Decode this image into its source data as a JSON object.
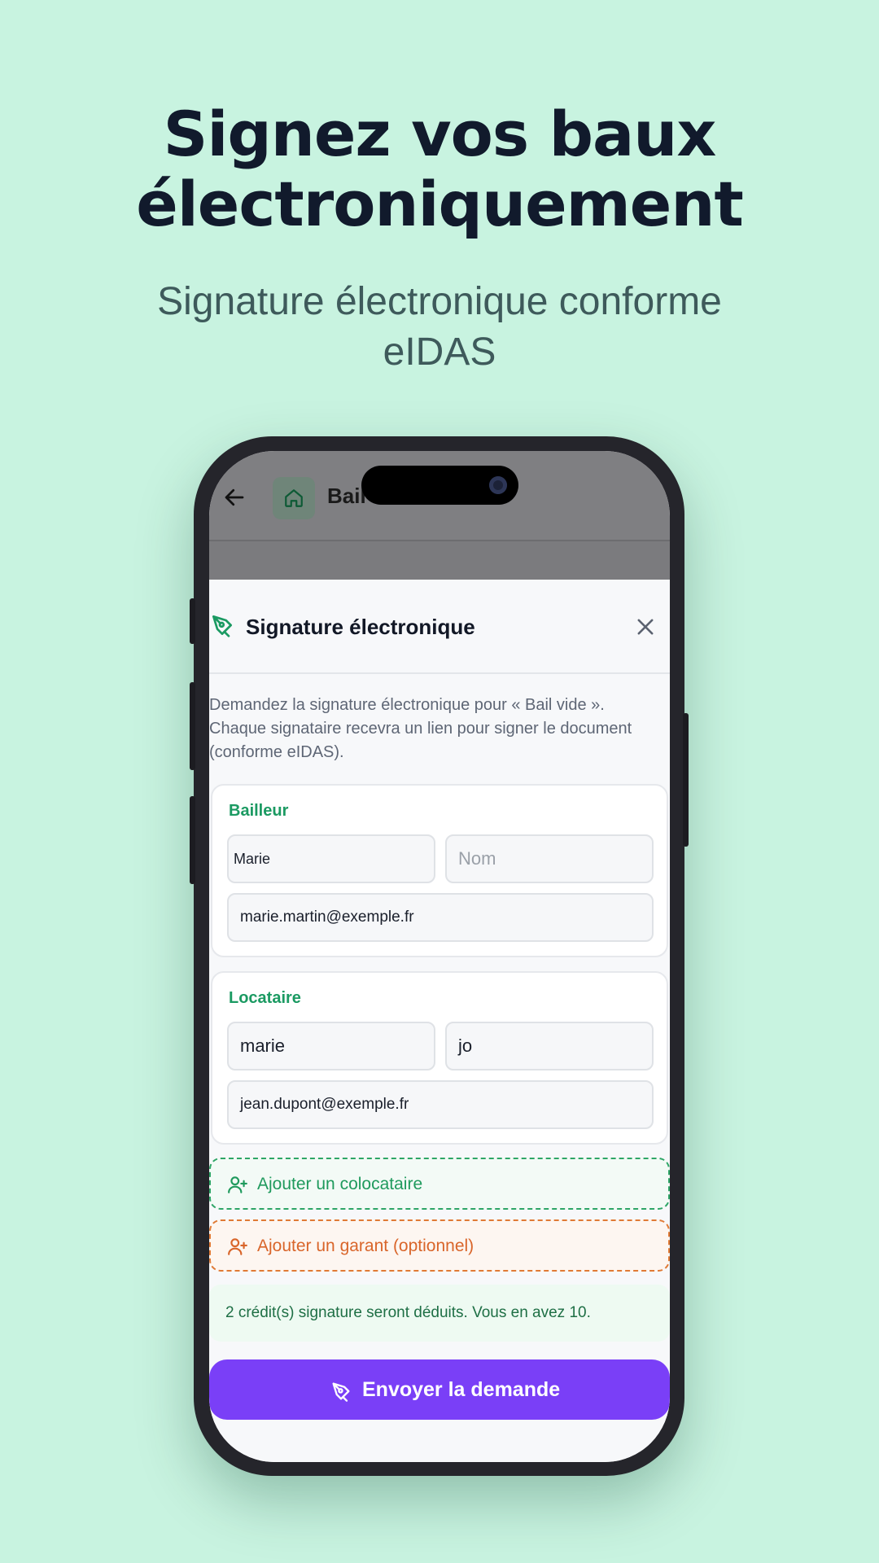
{
  "promo": {
    "headline_line1": "Signez vos baux",
    "headline_line2": "électroniquement",
    "subtitle_line1": "Signature électronique conforme",
    "subtitle_line2": "eIDAS"
  },
  "app_bar": {
    "title": "Bail vide",
    "back_icon": "arrow-left-icon",
    "home_icon": "home-icon"
  },
  "sheet": {
    "title": "Signature électronique",
    "title_icon": "pen-signature-icon",
    "close_icon": "close-icon",
    "description_line1": "Demandez la signature électronique pour « Bail vide ».",
    "description_line2": "Chaque signataire recevra un lien pour signer le document",
    "description_line3": "(conforme eIDAS)."
  },
  "bailleur": {
    "label": "Bailleur",
    "first_name_value": "Marie",
    "last_name_placeholder": "Nom",
    "email_value": "marie.martin@exemple.fr"
  },
  "locataire": {
    "label": "Locataire",
    "first_name_value": "marie",
    "last_name_value": "jo",
    "email_value": "jean.dupont@exemple.fr"
  },
  "actions": {
    "add_cotenant": "Ajouter un colocataire",
    "add_guarantor": "Ajouter un garant (optionnel)",
    "credits_note": "2 crédit(s) signature seront déduits. Vous en avez 10.",
    "send_label": "Envoyer la demande"
  },
  "colors": {
    "background": "#c8f3e0",
    "accent_green": "#1b9a62",
    "accent_orange": "#d9652a",
    "primary_purple": "#7a3ff7"
  }
}
